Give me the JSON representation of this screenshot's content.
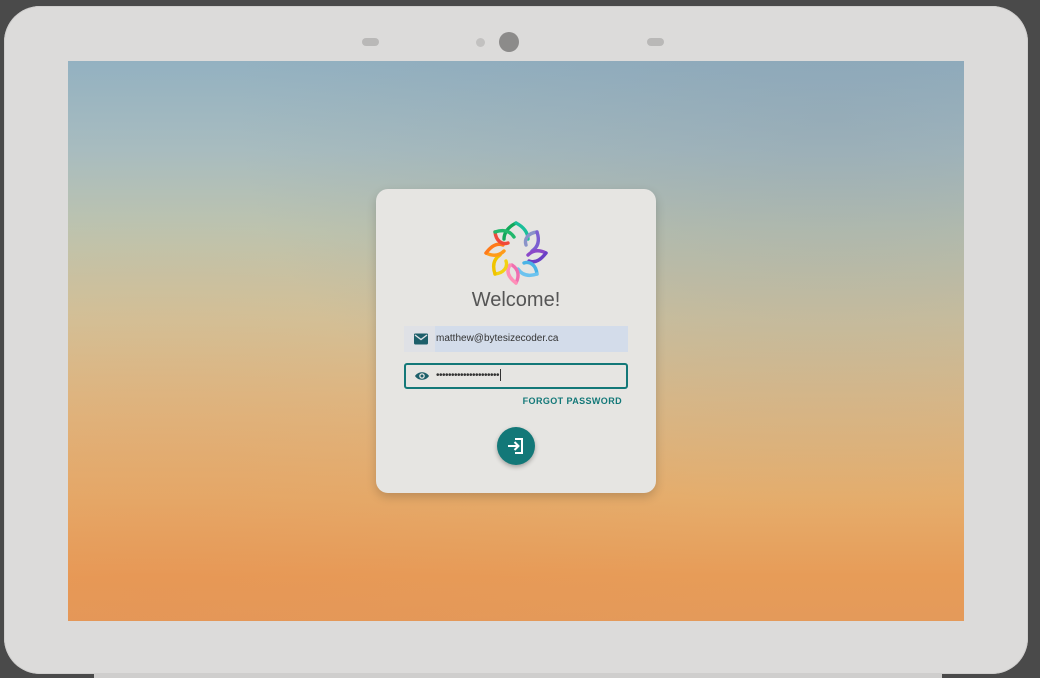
{
  "device": {
    "name": "smart display"
  },
  "login": {
    "welcome_text": "Welcome!",
    "email_value": "matthew@bytesizecoder.ca",
    "password_value": "•••••••••••••••••••••",
    "forgot_password_label": "FORGOT PASSWORD"
  },
  "icons": {
    "logo": "logo-icon",
    "email": "email-icon",
    "password": "visibility-icon",
    "login": "login-icon"
  },
  "colors": {
    "accent": "#137878",
    "card_background": "#e6e5e2",
    "email_field_background": "#d3dcea"
  }
}
